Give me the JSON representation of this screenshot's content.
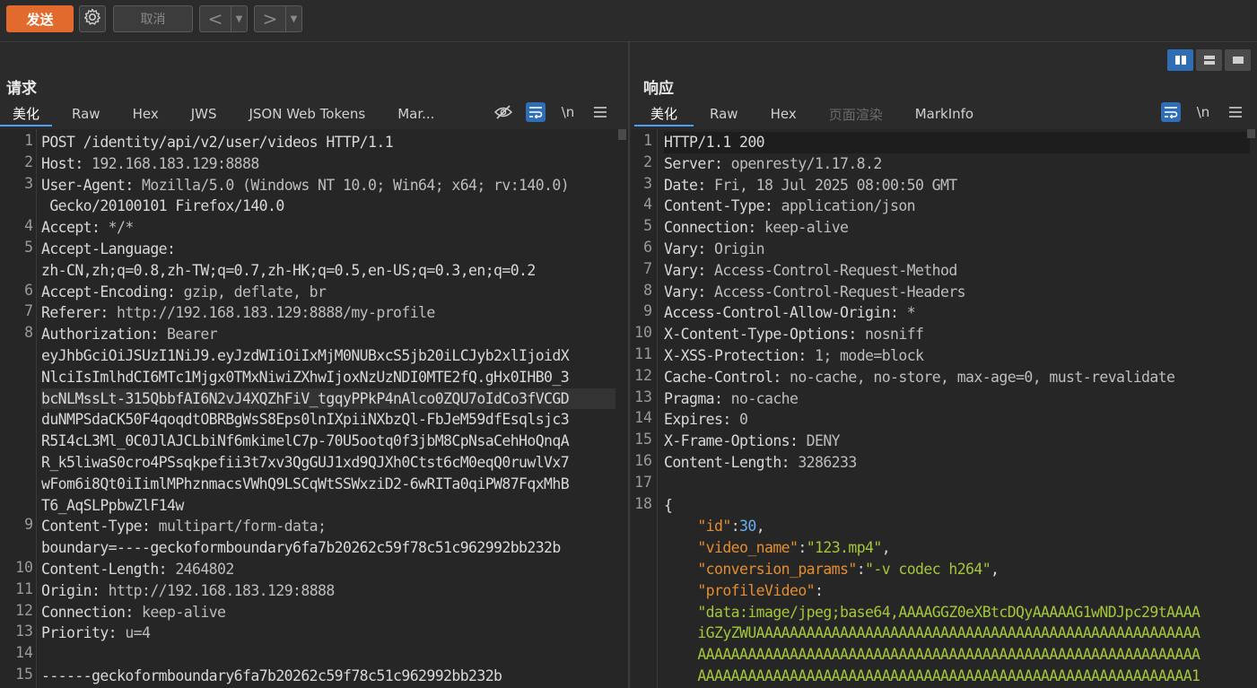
{
  "toolbar": {
    "send": "发送",
    "cancel": "取消",
    "back": "<",
    "forward": ">",
    "dropdown": "▼"
  },
  "request": {
    "title": "请求",
    "tabs": [
      "美化",
      "Raw",
      "Hex",
      "JWS",
      "JSON Web Tokens",
      "Mar..."
    ],
    "tools": {
      "newline": "\\n"
    },
    "lines": [
      {
        "n": "1",
        "text": "POST /identity/api/v2/user/videos HTTP/1.1"
      },
      {
        "n": "2",
        "key": "Host",
        "val": " 192.168.183.129:8888"
      },
      {
        "n": "3",
        "key": "User-Agent",
        "val": " Mozilla/5.0 (Windows NT 10.0; Win64; x64; rv:140.0)"
      },
      {
        "n": "",
        "text": " Gecko/20100101 Firefox/140.0"
      },
      {
        "n": "4",
        "key": "Accept",
        "val": " */*"
      },
      {
        "n": "5",
        "key": "Accept-Language",
        "val": ""
      },
      {
        "n": "",
        "text": "zh-CN,zh;q=0.8,zh-TW;q=0.7,zh-HK;q=0.5,en-US;q=0.3,en;q=0.2"
      },
      {
        "n": "6",
        "key": "Accept-Encoding",
        "val": " gzip, deflate, br"
      },
      {
        "n": "7",
        "key": "Referer",
        "val": " http://192.168.183.129:8888/my-profile"
      },
      {
        "n": "8",
        "key": "Authorization",
        "val": " Bearer"
      },
      {
        "n": "",
        "text": "eyJhbGciOiJSUzI1NiJ9.eyJzdWIiOiIxMjM0NUBxcS5jb20iLCJyb2xlIjoidX"
      },
      {
        "n": "",
        "text": "NlciIsImlhdCI6MTc1Mjgx0TMxNiwiZXhwIjoxNzUzNDI0MTE2fQ.gHx0IHB0_3"
      },
      {
        "n": "",
        "text": "bcNLMssLt-315QbbfAI6N2vJ4XQZhFiV_tgqyPPkP4nAlco0ZQU7oIdCo3fVCGD",
        "sel": true
      },
      {
        "n": "",
        "text": "duNMPSdaCK50F4qoqdtOBRBgWsS8Eps0lnIXpiiNXbzQl-FbJeM59dfEsqlsjc3"
      },
      {
        "n": "",
        "text": "R5I4cL3Ml_0C0JlAJCLbiNf6mkimelC7p-70U5ootq0f3jbM8CpNsaCehHoQnqA"
      },
      {
        "n": "",
        "text": "R_k5liwaS0cro4PSsqkpefii3t7xv3QgGUJ1xd9QJXh0Ctst6cM0eqQ0ruwlVx7"
      },
      {
        "n": "",
        "text": "wFom6i8Qt0iIimlMPhznmacsVWhQ9LSCqWtSSWxziD2-6wRITa0qiPW87FqxMhB"
      },
      {
        "n": "",
        "text": "T6_AqSLPpbwZlF14w"
      },
      {
        "n": "9",
        "key": "Content-Type",
        "val": " multipart/form-data;"
      },
      {
        "n": "",
        "text": "boundary=----geckoformboundary6fa7b20262c59f78c51c962992bb232b"
      },
      {
        "n": "10",
        "key": "Content-Length",
        "val": " 2464802"
      },
      {
        "n": "11",
        "key": "Origin",
        "val": " http://192.168.183.129:8888"
      },
      {
        "n": "12",
        "key": "Connection",
        "val": " keep-alive"
      },
      {
        "n": "13",
        "key": "Priority",
        "val": " u=4"
      },
      {
        "n": "14",
        "text": ""
      },
      {
        "n": "15",
        "text": "------geckoformboundary6fa7b20262c59f78c51c962992bb232b"
      }
    ]
  },
  "response": {
    "title": "响应",
    "tabs": [
      "美化",
      "Raw",
      "Hex",
      "页面渲染",
      "MarkInfo"
    ],
    "tools": {
      "newline": "\\n"
    },
    "lines": [
      {
        "n": "1",
        "text": "HTTP/1.1 200",
        "hl": true
      },
      {
        "n": "2",
        "key": "Server",
        "val": " openresty/1.17.8.2"
      },
      {
        "n": "3",
        "key": "Date",
        "val": " Fri, 18 Jul 2025 08:00:50 GMT"
      },
      {
        "n": "4",
        "key": "Content-Type",
        "val": " application/json"
      },
      {
        "n": "5",
        "key": "Connection",
        "val": " keep-alive"
      },
      {
        "n": "6",
        "key": "Vary",
        "val": " Origin"
      },
      {
        "n": "7",
        "key": "Vary",
        "val": " Access-Control-Request-Method"
      },
      {
        "n": "8",
        "key": "Vary",
        "val": " Access-Control-Request-Headers"
      },
      {
        "n": "9",
        "key": "Access-Control-Allow-Origin",
        "val": " *"
      },
      {
        "n": "10",
        "key": "X-Content-Type-Options",
        "val": " nosniff"
      },
      {
        "n": "11",
        "key": "X-XSS-Protection",
        "val": " 1; mode=block"
      },
      {
        "n": "12",
        "key": "Cache-Control",
        "val": " no-cache, no-store, max-age=0, must-revalidate"
      },
      {
        "n": "13",
        "key": "Pragma",
        "val": " no-cache"
      },
      {
        "n": "14",
        "key": "Expires",
        "val": " 0"
      },
      {
        "n": "15",
        "key": "X-Frame-Options",
        "val": " DENY"
      },
      {
        "n": "16",
        "key": "Content-Length",
        "val": " 3286233"
      },
      {
        "n": "17",
        "text": ""
      },
      {
        "n": "18",
        "text": "{"
      }
    ],
    "json": [
      {
        "key": "\"id\"",
        "sep": ":",
        "val": "30",
        "type": "num",
        "tail": ","
      },
      {
        "key": "\"video_name\"",
        "sep": ":",
        "val": "\"123.mp4\"",
        "type": "str",
        "tail": ","
      },
      {
        "key": "\"conversion_params\"",
        "sep": ":",
        "val": "\"-v codec h264\"",
        "type": "str",
        "tail": ","
      },
      {
        "key": "\"profileVideo\"",
        "sep": ":",
        "val": "",
        "type": "str",
        "tail": ""
      }
    ],
    "b64": [
      "\"data:image/jpeg;base64,AAAAGGZ0eXBtcDQyAAAAAG1wNDJpc29tAAAA",
      "iGZyZWUAAAAAAAAAAAAAAAAAAAAAAAAAAAAAAAAAAAAAAAAAAAAAAAAAAAAA",
      "AAAAAAAAAAAAAAAAAAAAAAAAAAAAAAAAAAAAAAAAAAAAAAAAAAAAAAAAAAAA",
      "AAAAAAAAAAAAAAAAAAAAAAAAAAAAAAAAAAAAAAAAAAAAAAAAAAAAAAAAAAA1"
    ]
  }
}
